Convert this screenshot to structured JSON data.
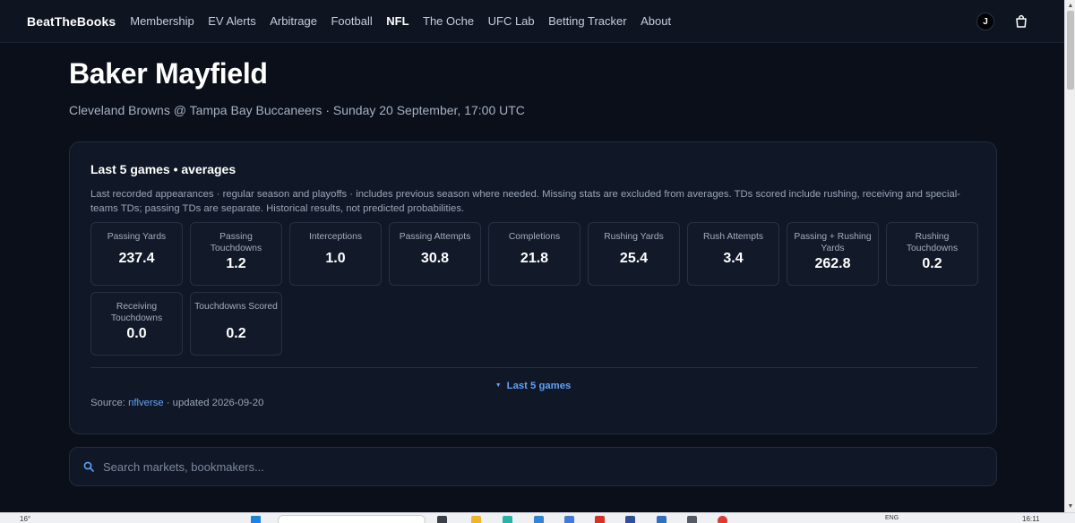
{
  "nav": {
    "brand": "BeatTheBooks",
    "links": [
      {
        "label": "Membership"
      },
      {
        "label": "EV Alerts"
      },
      {
        "label": "Arbitrage"
      },
      {
        "label": "Football"
      },
      {
        "label": "NFL"
      },
      {
        "label": "The Oche"
      },
      {
        "label": "UFC Lab"
      },
      {
        "label": "Betting Tracker"
      },
      {
        "label": "About"
      }
    ],
    "active": "NFL",
    "avatar_initial": "J",
    "cart_icon": "shopping-bag-icon"
  },
  "player": {
    "name": "Baker Mayfield",
    "subtitle": "Cleveland Browns @ Tampa Bay Buccaneers · Sunday 20 September, 17:00 UTC"
  },
  "stats_card": {
    "title": "Last 5 games • averages",
    "description": "Last recorded appearances · regular season and playoffs · includes previous season where needed. Missing stats are excluded from averages. TDs scored include rushing, receiving and special-teams TDs; passing TDs are separate. Historical results, not predicted probabilities.",
    "stats": [
      {
        "label": "Passing Yards",
        "value": "237.4"
      },
      {
        "label": "Passing Touchdowns",
        "value": "1.2"
      },
      {
        "label": "Interceptions",
        "value": "1.0"
      },
      {
        "label": "Passing Attempts",
        "value": "30.8"
      },
      {
        "label": "Completions",
        "value": "21.8"
      },
      {
        "label": "Rushing Yards",
        "value": "25.4"
      },
      {
        "label": "Rush Attempts",
        "value": "3.4"
      },
      {
        "label": "Passing + Rushing Yards",
        "value": "262.8"
      },
      {
        "label": "Rushing Touchdowns",
        "value": "0.2"
      },
      {
        "label": "Receiving Touchdowns",
        "value": "0.0"
      },
      {
        "label": "Touchdowns Scored",
        "value": "0.2"
      }
    ],
    "toggle_label": "Last 5 games",
    "source_prefix": "Source:",
    "source_link": "nflverse",
    "source_suffix": "· updated 2026-09-20"
  },
  "search": {
    "placeholder": "Search markets, bookmakers..."
  },
  "taskbar": {
    "weather": "16°",
    "language": "ENG",
    "time": "16:11"
  },
  "colors": {
    "background": "#0a0f1a",
    "card": "#101827",
    "accent": "#5fa2f7",
    "text": "#ffffff",
    "muted": "#9aa5b7"
  }
}
